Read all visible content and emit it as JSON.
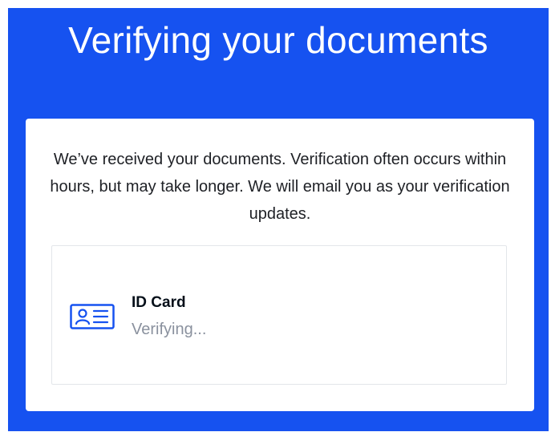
{
  "header": {
    "title": "Verifying your documents"
  },
  "card": {
    "message": "We’ve received your documents. Verification often occurs within hours, but may take longer. We will email you as your verification updates.",
    "document": {
      "icon": "id-card-icon",
      "name": "ID Card",
      "status": "Verifying..."
    }
  },
  "colors": {
    "brand_blue": "#1652f0",
    "status_gray": "#8a919e"
  }
}
